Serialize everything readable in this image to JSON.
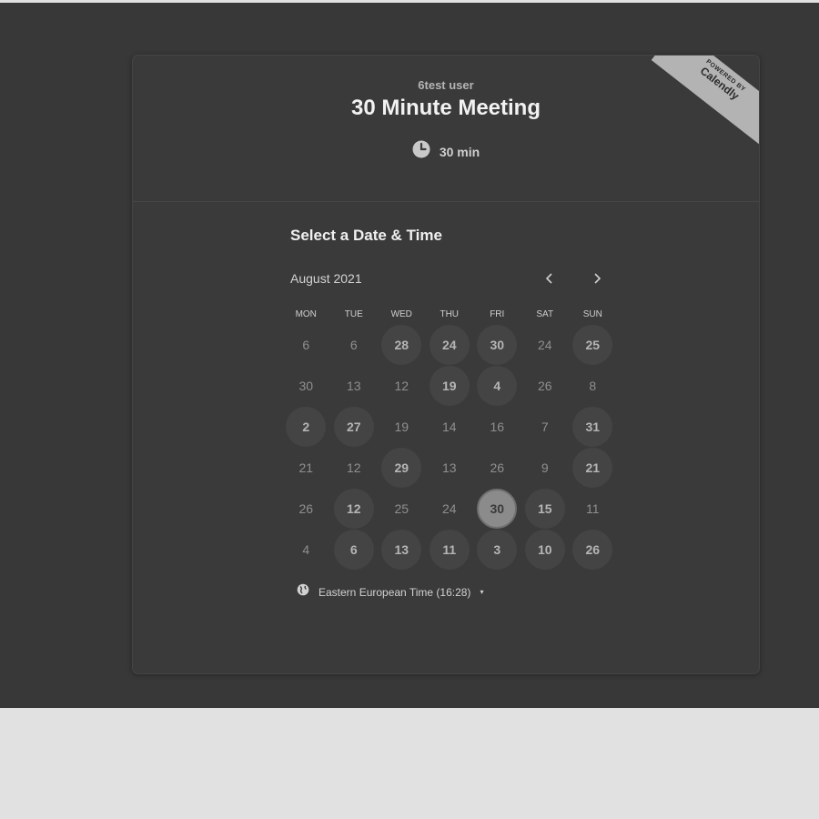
{
  "event": {
    "organizer": "6test user",
    "title": "30 Minute Meeting",
    "duration": "30 min",
    "duration_icon": "clock-icon"
  },
  "badge": {
    "small": "POWERED BY",
    "brand": "Calendly"
  },
  "calendar": {
    "section_title": "Select a Date & Time",
    "month": "August 2021",
    "prev_icon": "chevron-left-icon",
    "next_icon": "chevron-right-icon",
    "weekdays": [
      "MON",
      "TUE",
      "WED",
      "THU",
      "FRI",
      "SAT",
      "SUN"
    ],
    "rows": [
      [
        "6",
        "6",
        "28",
        "24",
        "30",
        "24",
        "25"
      ],
      [
        "30",
        "13",
        "12",
        "19",
        "4",
        "26",
        "8"
      ],
      [
        "2",
        "27",
        "19",
        "14",
        "16",
        "7",
        "31"
      ],
      [
        "21",
        "12",
        "29",
        "13",
        "26",
        "9",
        "21"
      ],
      [
        "26",
        "12",
        "25",
        "24",
        "30",
        "15",
        "11"
      ],
      [
        "4",
        "6",
        "13",
        "11",
        "3",
        "10",
        "26"
      ]
    ],
    "available": [
      [
        0,
        2
      ],
      [
        0,
        3
      ],
      [
        0,
        4
      ],
      [
        0,
        6
      ],
      [
        1,
        3
      ],
      [
        1,
        4
      ],
      [
        2,
        0
      ],
      [
        2,
        1
      ],
      [
        2,
        6
      ],
      [
        3,
        2
      ],
      [
        3,
        6
      ],
      [
        4,
        1
      ],
      [
        4,
        4
      ],
      [
        4,
        5
      ],
      [
        5,
        1
      ],
      [
        5,
        2
      ],
      [
        5,
        3
      ],
      [
        5,
        4
      ],
      [
        5,
        5
      ],
      [
        5,
        6
      ]
    ],
    "selected": [
      4,
      4
    ]
  },
  "timezone": {
    "icon": "globe-icon",
    "label": "Eastern European Time (16:28)",
    "caret": "▾"
  },
  "colors": {
    "page_bg": "#383838",
    "card_bg": "#3a3a3a",
    "available_day": "#444444",
    "selected_day": "#8b8b8b",
    "badge": "#b3b3b3"
  }
}
